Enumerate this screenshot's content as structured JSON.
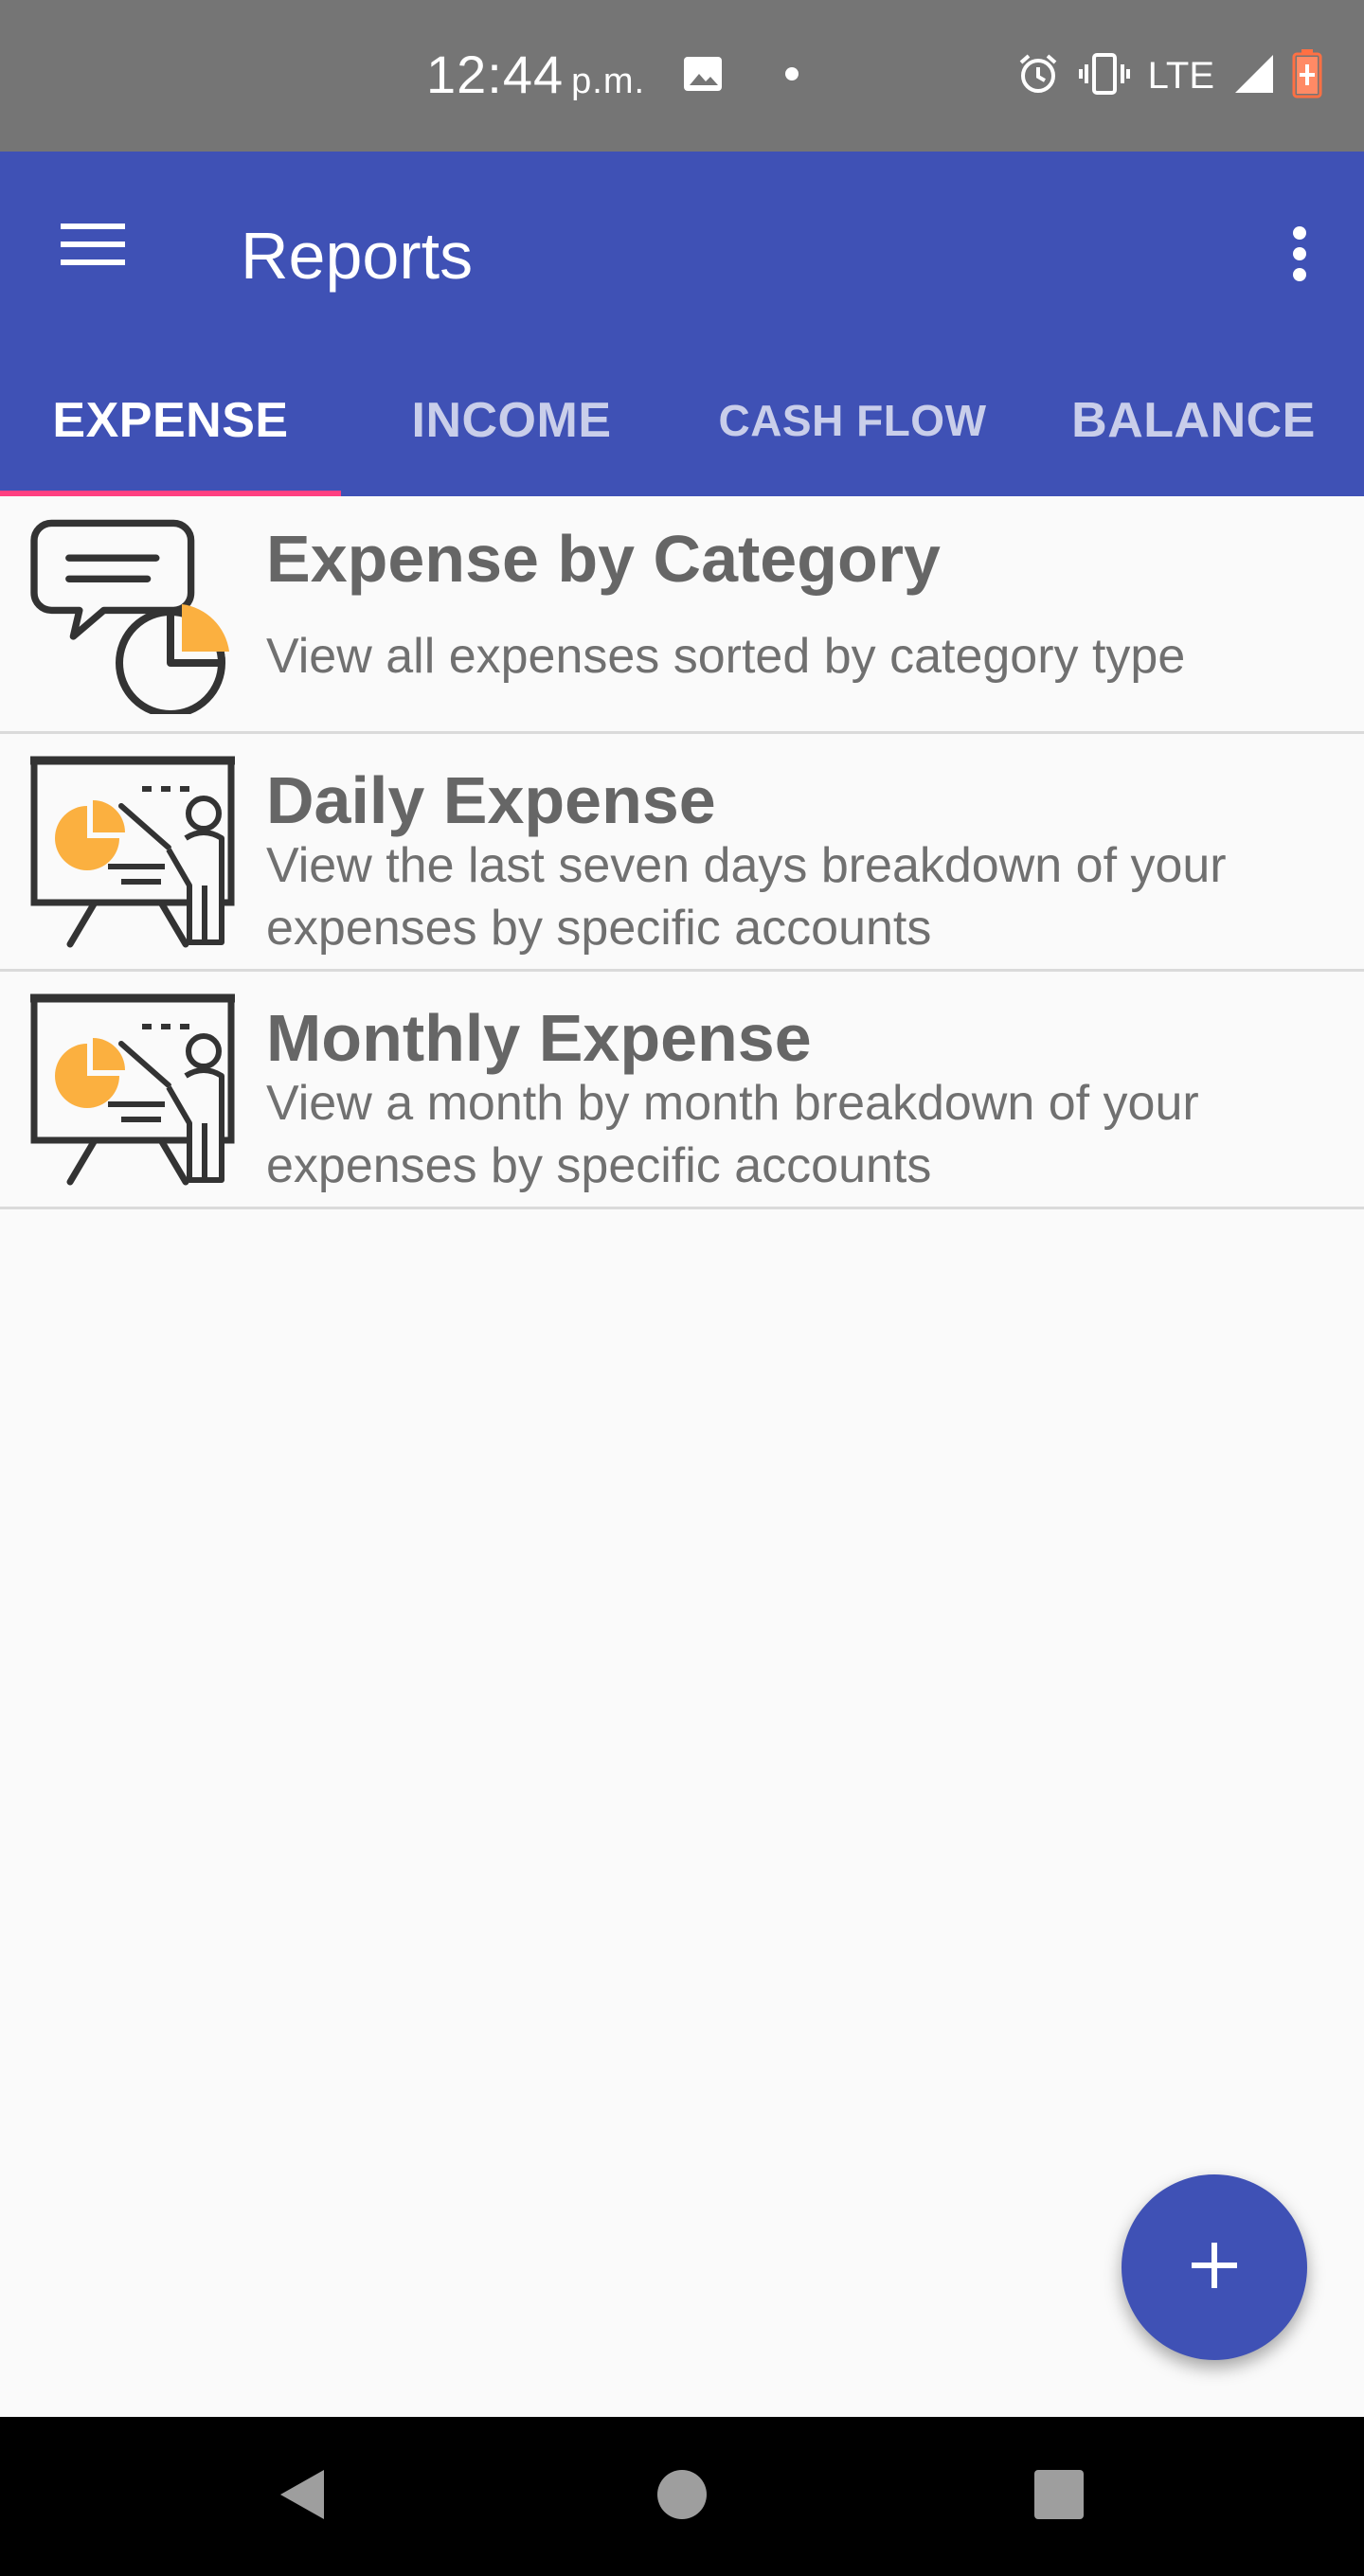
{
  "status_bar": {
    "time": "12:44",
    "ampm": "p.m.",
    "network": "LTE",
    "icons": [
      "image-icon",
      "dot-icon",
      "alarm-icon",
      "vibrate-icon",
      "signal-icon",
      "battery-charging-icon"
    ]
  },
  "app_bar": {
    "title": "Reports",
    "menu_icon": "hamburger-menu-icon",
    "overflow_icon": "more-vert-icon",
    "tabs": [
      {
        "label": "EXPENSE",
        "active": true
      },
      {
        "label": "INCOME",
        "active": false
      },
      {
        "label": "CASH FLOW",
        "active": false
      },
      {
        "label": "BALANCE",
        "active": false
      }
    ]
  },
  "reports": [
    {
      "title": "Expense by Category",
      "description": "View all expenses sorted by category type",
      "icon": "chat-pie-chart-icon"
    },
    {
      "title": "Daily Expense",
      "description": "View the last seven days breakdown of your expenses by specific accounts",
      "icon": "presentation-board-icon"
    },
    {
      "title": "Monthly Expense",
      "description": "View a month by month breakdown of your expenses by specific accounts",
      "icon": "presentation-board-icon"
    }
  ],
  "fab": {
    "icon": "plus-icon"
  },
  "nav_bar": {
    "icons": [
      "back-icon",
      "home-icon",
      "recents-icon"
    ]
  },
  "colors": {
    "primary": "#3f51b5",
    "accent": "#ff4081",
    "icon_orange": "#fbb040",
    "status_bar": "#757575"
  }
}
